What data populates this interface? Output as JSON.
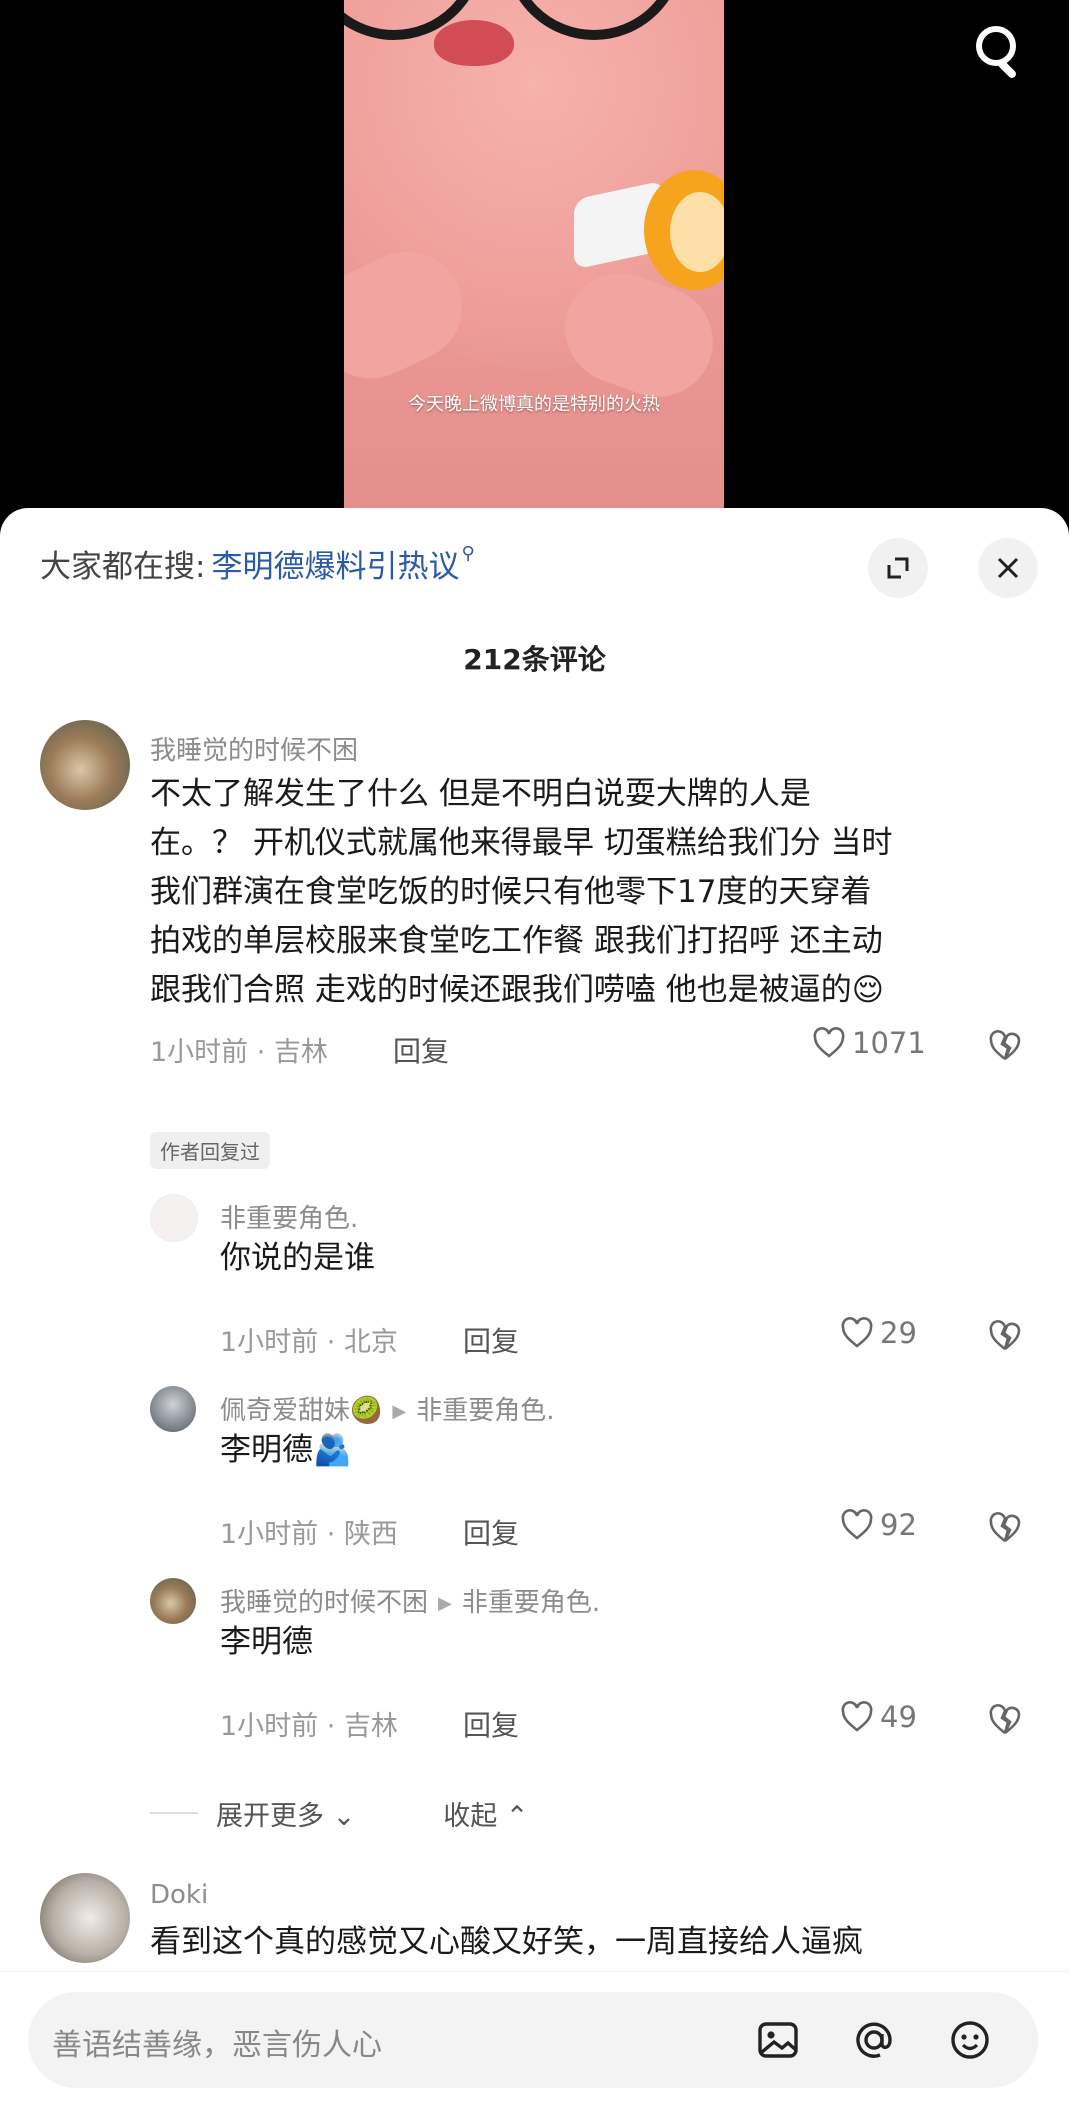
{
  "video": {
    "caption": "今天晚上微博真的是特别的火热"
  },
  "header": {
    "hot_label": "大家都在搜:",
    "hot_link": "李明德爆料引热议",
    "comment_count": "212条评论"
  },
  "comments": [
    {
      "username": "我睡觉的时候不困",
      "lines": [
        "不太了解发生了什么 但是不明白说耍大牌的人是",
        "在。？ 开机仪式就属他来得最早 切蛋糕给我们分 当时",
        "我们群演在食堂吃饭的时候只有他零下17度的天穿着",
        "拍戏的单层校服来食堂吃工作餐 跟我们打招呼 还主动",
        "跟我们合照 走戏的时候还跟我们唠嗑 他也是被逼的😌"
      ],
      "time": "1小时前",
      "location": "吉林",
      "reply": "回复",
      "likes": "1071",
      "badge": "作者回复过"
    },
    {
      "username": "非重要角色.",
      "text": "你说的是谁",
      "time": "1小时前",
      "location": "北京",
      "reply": "回复",
      "likes": "29"
    },
    {
      "username": "佩奇爱甜妹🥝",
      "reply_to": "非重要角色.",
      "text": "李明德🫂",
      "time": "1小时前",
      "location": "陕西",
      "reply": "回复",
      "likes": "92"
    },
    {
      "username": "我睡觉的时候不困",
      "reply_to": "非重要角色.",
      "text": "李明德",
      "time": "1小时前",
      "location": "吉林",
      "reply": "回复",
      "likes": "49"
    },
    {
      "username": "Doki",
      "text": "看到这个真的感觉又心酸又好笑，一周直接给人逼疯"
    }
  ],
  "thread_actions": {
    "expand_more": "展开更多",
    "collapse": "收起"
  },
  "input": {
    "placeholder": "善语结善缘，恶言伤人心"
  },
  "icons": [
    "search-icon",
    "expand-icon",
    "close-icon",
    "heart-icon",
    "broken-heart-icon",
    "image-icon",
    "at-icon",
    "emoji-icon"
  ]
}
